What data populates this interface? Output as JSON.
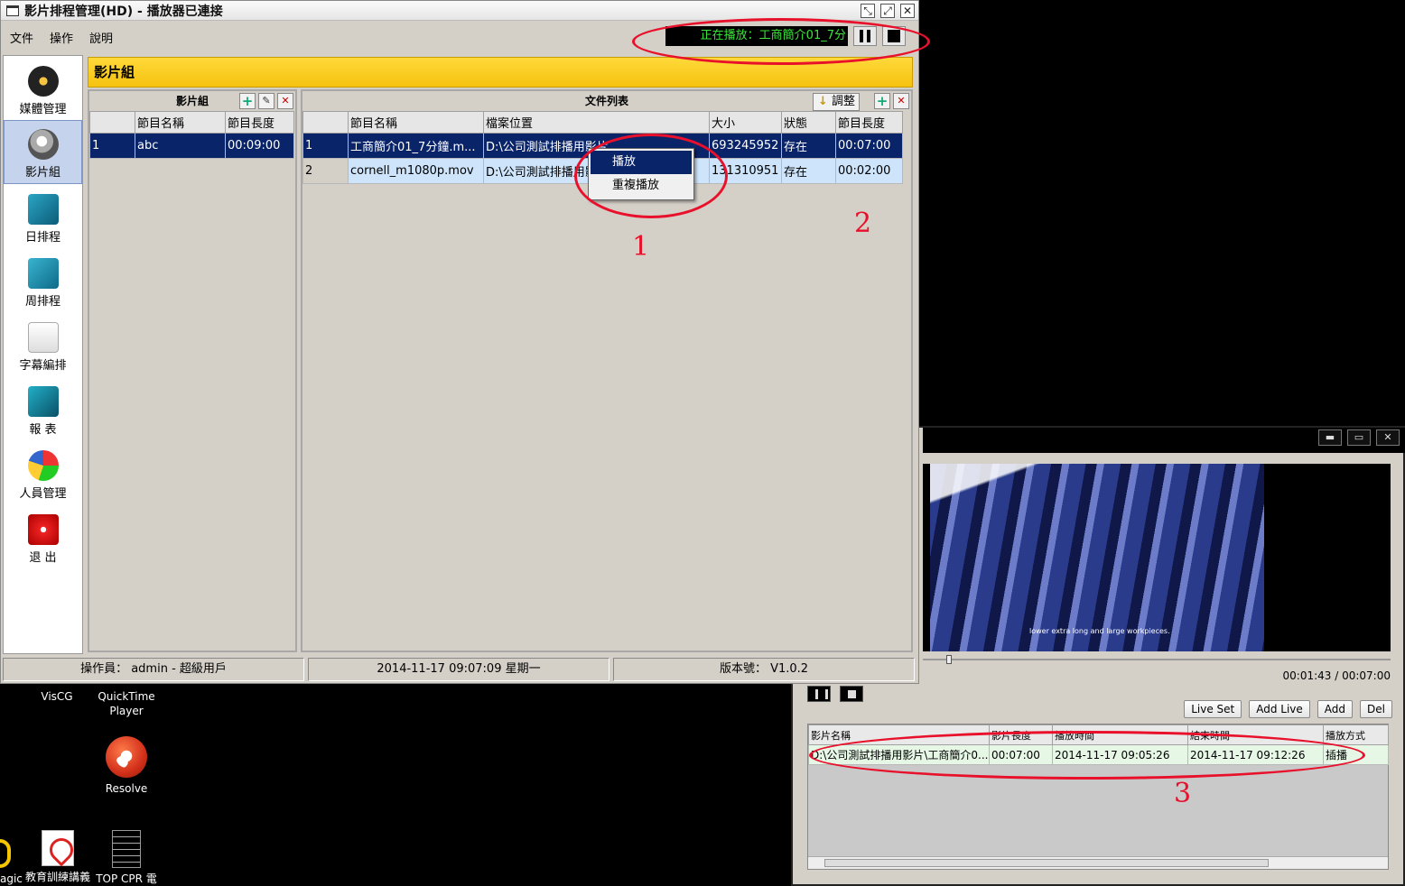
{
  "desktop": {
    "icons": [
      {
        "label": "VisCG"
      },
      {
        "label": "QuickTime Player"
      },
      {
        "label": "Resolve"
      },
      {
        "label": "agic"
      },
      {
        "label": "教育訓練講義"
      },
      {
        "label": "TOP CPR 電"
      }
    ]
  },
  "main_window": {
    "title": "影片排程管理(HD) - 播放器已連接",
    "menu": [
      "文件",
      "操作",
      "說明"
    ],
    "now_playing": "正在播放：工商簡介01_7分",
    "sidebar": [
      {
        "label": "媒體管理",
        "icon": "disc-icon"
      },
      {
        "label": "影片組",
        "icon": "video-group-icon"
      },
      {
        "label": "日排程",
        "icon": "daily-schedule-icon"
      },
      {
        "label": "周排程",
        "icon": "weekly-schedule-icon"
      },
      {
        "label": "字幕編排",
        "icon": "subtitle-icon"
      },
      {
        "label": "報 表",
        "icon": "report-icon"
      },
      {
        "label": "人員管理",
        "icon": "user-management-icon"
      },
      {
        "label": "退 出",
        "icon": "exit-icon"
      }
    ],
    "section_title": "影片組",
    "group_panel": {
      "title": "影片組",
      "columns": [
        "",
        "節目名稱",
        "節目長度"
      ],
      "rows": [
        {
          "idx": "1",
          "name": "abc",
          "length": "00:09:00"
        }
      ]
    },
    "file_panel": {
      "title": "文件列表",
      "adjust_label": "調整",
      "columns": [
        "",
        "節目名稱",
        "檔案位置",
        "大小",
        "狀態",
        "節目長度"
      ],
      "rows": [
        {
          "idx": "1",
          "name": "工商簡介01_7分鐘.m...",
          "path": "D:\\公司測試排播用影片...",
          "size": "693245952",
          "status": "存在",
          "length": "00:07:00"
        },
        {
          "idx": "2",
          "name": "cornell_m1080p.mov",
          "path": "D:\\公司測試排播用影片...",
          "size": "131310951",
          "status": "存在",
          "length": "00:02:00"
        }
      ]
    },
    "context_menu": [
      "播放",
      "重複播放"
    ],
    "status": {
      "operator": "操作員： admin - 超級用戶",
      "datetime": "2014-11-17 09:07:09 星期一",
      "version": "版本號： V1.0.2"
    }
  },
  "annotations": [
    "1",
    "2",
    "3"
  ],
  "player_window": {
    "video_subtitle": "lower extra long and large workpieces.",
    "time": "00:01:43 / 00:07:00",
    "seek_fraction": 0.05,
    "buttons": [
      "Live Set",
      "Add Live",
      "Add",
      "Del"
    ],
    "queue": {
      "columns": [
        "影片名稱",
        "影片長度",
        "播放時間",
        "結束時間",
        "播放方式"
      ],
      "rows": [
        {
          "name": "D:\\公司測試排播用影片\\工商簡介0...",
          "length": "00:07:00",
          "start": "2014-11-17 09:05:26",
          "end": "2014-11-17 09:12:26",
          "mode": "插播"
        }
      ]
    }
  },
  "colors": {
    "annotation_red": "#e8102a",
    "selection_blue": "#0a246a",
    "section_yellow": "#ffd93a",
    "now_playing_green": "#39e639"
  }
}
